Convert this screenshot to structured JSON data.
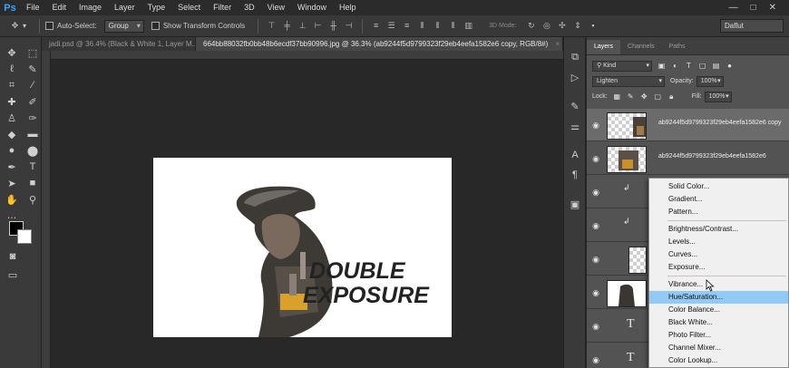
{
  "app": {
    "logo": "Ps",
    "window_controls": [
      "—",
      "□",
      "✕"
    ]
  },
  "menu": [
    "File",
    "Edit",
    "Image",
    "Layer",
    "Type",
    "Select",
    "Filter",
    "3D",
    "View",
    "Window",
    "Help"
  ],
  "options": {
    "auto_select_label": "Auto-Select:",
    "auto_select_value": "Group",
    "transform_label": "Show Transform Controls",
    "mode_3d": "3D Mode:",
    "workspace": "Daflut"
  },
  "tabs": [
    {
      "label": "jadi.psd @ 36.4% (Black & White 1, Layer M...",
      "close": "×"
    },
    {
      "label": "664bb88032fb0bb48b6ecdf37bb90996.jpg @ 36.3% (ab9244f5d9799323f29eb4eefa1582e6 copy, RGB/8#)",
      "close": "×"
    }
  ],
  "panel": {
    "tabs": [
      "Layers",
      "Channels",
      "Paths"
    ],
    "filter_kind": "Kind",
    "blend_mode": "Lighten",
    "opacity_label": "Opacity:",
    "opacity_value": "100%",
    "lock_label": "Lock:",
    "fill_label": "Fill:",
    "fill_value": "100%"
  },
  "layers": [
    {
      "name": "ab9244f5d9799323f29eb4eefa1582e6  copy",
      "selected": true
    },
    {
      "name": "ab9244f5d9799323f29eb4eefa1582e6",
      "selected": false
    }
  ],
  "adjustment_menu": {
    "group1": [
      "Solid Color...",
      "Gradient...",
      "Pattern..."
    ],
    "group2": [
      "Brightness/Contrast...",
      "Levels...",
      "Curves...",
      "Exposure..."
    ],
    "group3": [
      "Vibrance...",
      "Hue/Saturation...",
      "Color Balance...",
      "Black  White...",
      "Photo Filter...",
      "Channel Mixer...",
      "Color Lookup..."
    ],
    "highlighted": "Hue/Saturation..."
  },
  "artwork": {
    "line1": "DOUBLE",
    "line2": "EXPOSURE"
  },
  "colors": {
    "accent": "#31a8ff",
    "highlight": "#91c9f7",
    "panel": "#535353"
  }
}
